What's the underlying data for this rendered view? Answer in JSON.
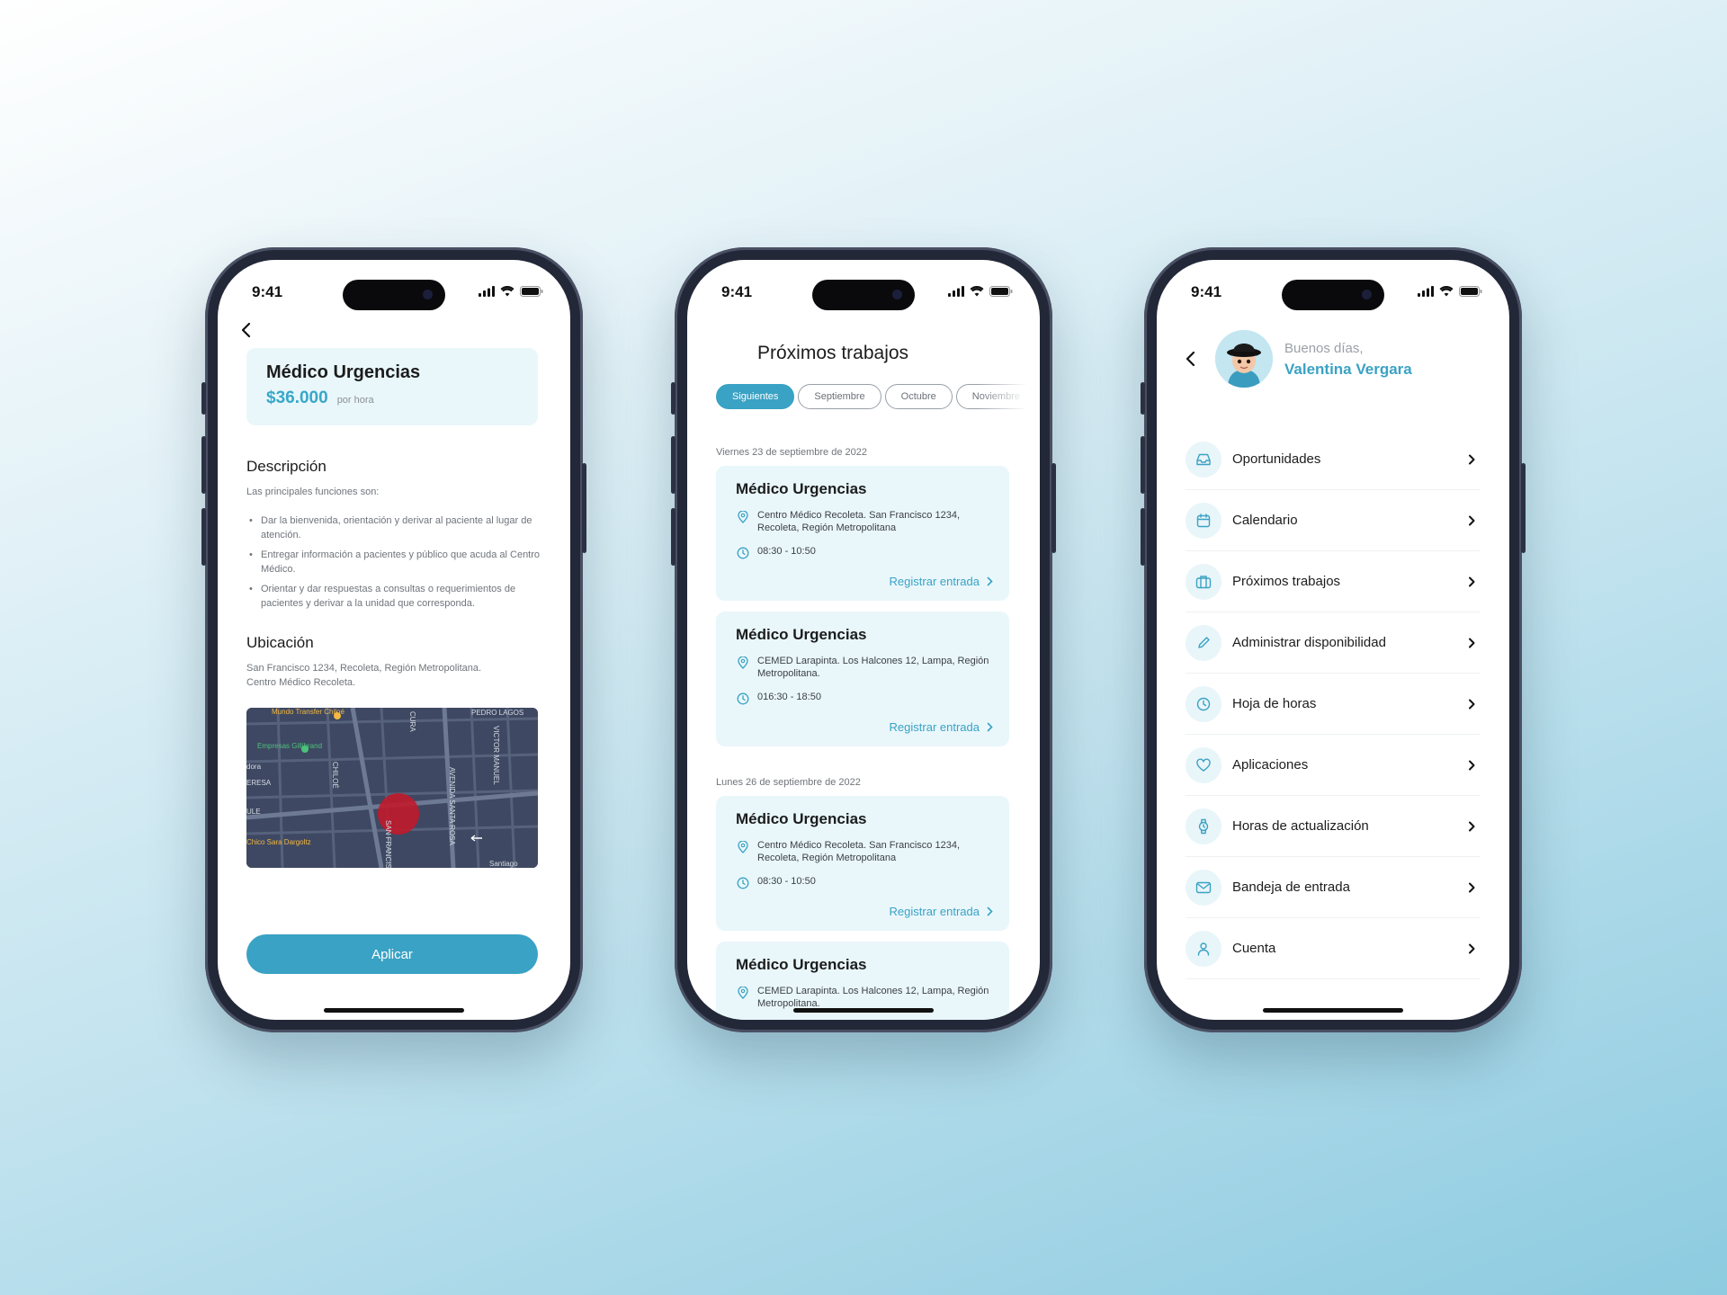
{
  "colors": {
    "accent": "#3aa2c4",
    "card_bg": "#e9f7fb",
    "phone_frame": "#232838"
  },
  "status": {
    "time": "9:41"
  },
  "detail": {
    "job_title": "Médico Urgencias",
    "price": "$36.000",
    "price_unit": "por hora",
    "description_title": "Descripción",
    "description_intro": "Las principales funciones son:",
    "bullets": [
      "Dar la bienvenida, orientación y derivar al paciente al lugar de atención.",
      "Entregar información a pacientes y público que acuda al Centro Médico.",
      "Orientar y dar respuestas a consultas o requerimientos de pacientes y derivar a la unidad que corresponda."
    ],
    "location_title": "Ubicación",
    "location_line1": "San Francisco 1234, Recoleta, Región Metropolitana.",
    "location_line2": "Centro Médico Recoleta.",
    "map_labels": {
      "poi1": "Mundo Transfer Chiloé",
      "poi2": "Empresas Gillibrand",
      "poi3": "Chico Sara Dargoltz",
      "street1": "AVENIDA SANTA ROSA",
      "street2": "SAN FRANCISCO",
      "street3": "PEDRO LAGOS",
      "street4": "VICTOR MANUEL",
      "poi4": "Santiago",
      "frag1": "ULE",
      "frag2": "ERESA",
      "frag3": "dora",
      "frag4": "CHILOÉ",
      "frag5": "CURA"
    },
    "apply_label": "Aplicar"
  },
  "jobs": {
    "title": "Próximos trabajos",
    "tabs": [
      "Siguientes",
      "Septiembre",
      "Octubre",
      "Noviembre"
    ],
    "groups": [
      {
        "date": "Viernes 23 de septiembre de 2022",
        "items": [
          {
            "title": "Médico Urgencias",
            "address": "Centro Médico Recoleta. San Francisco 1234, Recoleta, Región Metropolitana",
            "time": "08:30 - 10:50",
            "action": "Registrar entrada"
          },
          {
            "title": "Médico Urgencias",
            "address": "CEMED Larapinta. Los Halcones 12, Lampa, Región Metropolitana.",
            "time": "016:30 - 18:50",
            "action": "Registrar entrada"
          }
        ]
      },
      {
        "date": "Lunes 26 de septiembre de 2022",
        "items": [
          {
            "title": "Médico Urgencias",
            "address": "Centro Médico Recoleta. San Francisco 1234, Recoleta, Región Metropolitana",
            "time": "08:30 - 10:50",
            "action": "Registrar entrada"
          },
          {
            "title": "Médico Urgencias",
            "address": "CEMED Larapinta. Los Halcones 12, Lampa, Región Metropolitana.",
            "time": "",
            "action": ""
          }
        ]
      }
    ]
  },
  "menu": {
    "greeting": "Buenos días,",
    "user_name": "Valentina Vergara",
    "items": [
      {
        "label": "Oportunidades",
        "icon": "inbox-icon"
      },
      {
        "label": "Calendario",
        "icon": "calendar-icon"
      },
      {
        "label": "Próximos trabajos",
        "icon": "briefcase-icon"
      },
      {
        "label": "Administrar disponibilidad",
        "icon": "pencil-icon"
      },
      {
        "label": "Hoja de horas",
        "icon": "clock-icon"
      },
      {
        "label": "Aplicaciones",
        "icon": "heart-icon"
      },
      {
        "label": "Horas de actualización",
        "icon": "watch-icon"
      },
      {
        "label": "Bandeja de entrada",
        "icon": "mail-icon"
      },
      {
        "label": "Cuenta",
        "icon": "user-icon"
      }
    ]
  }
}
